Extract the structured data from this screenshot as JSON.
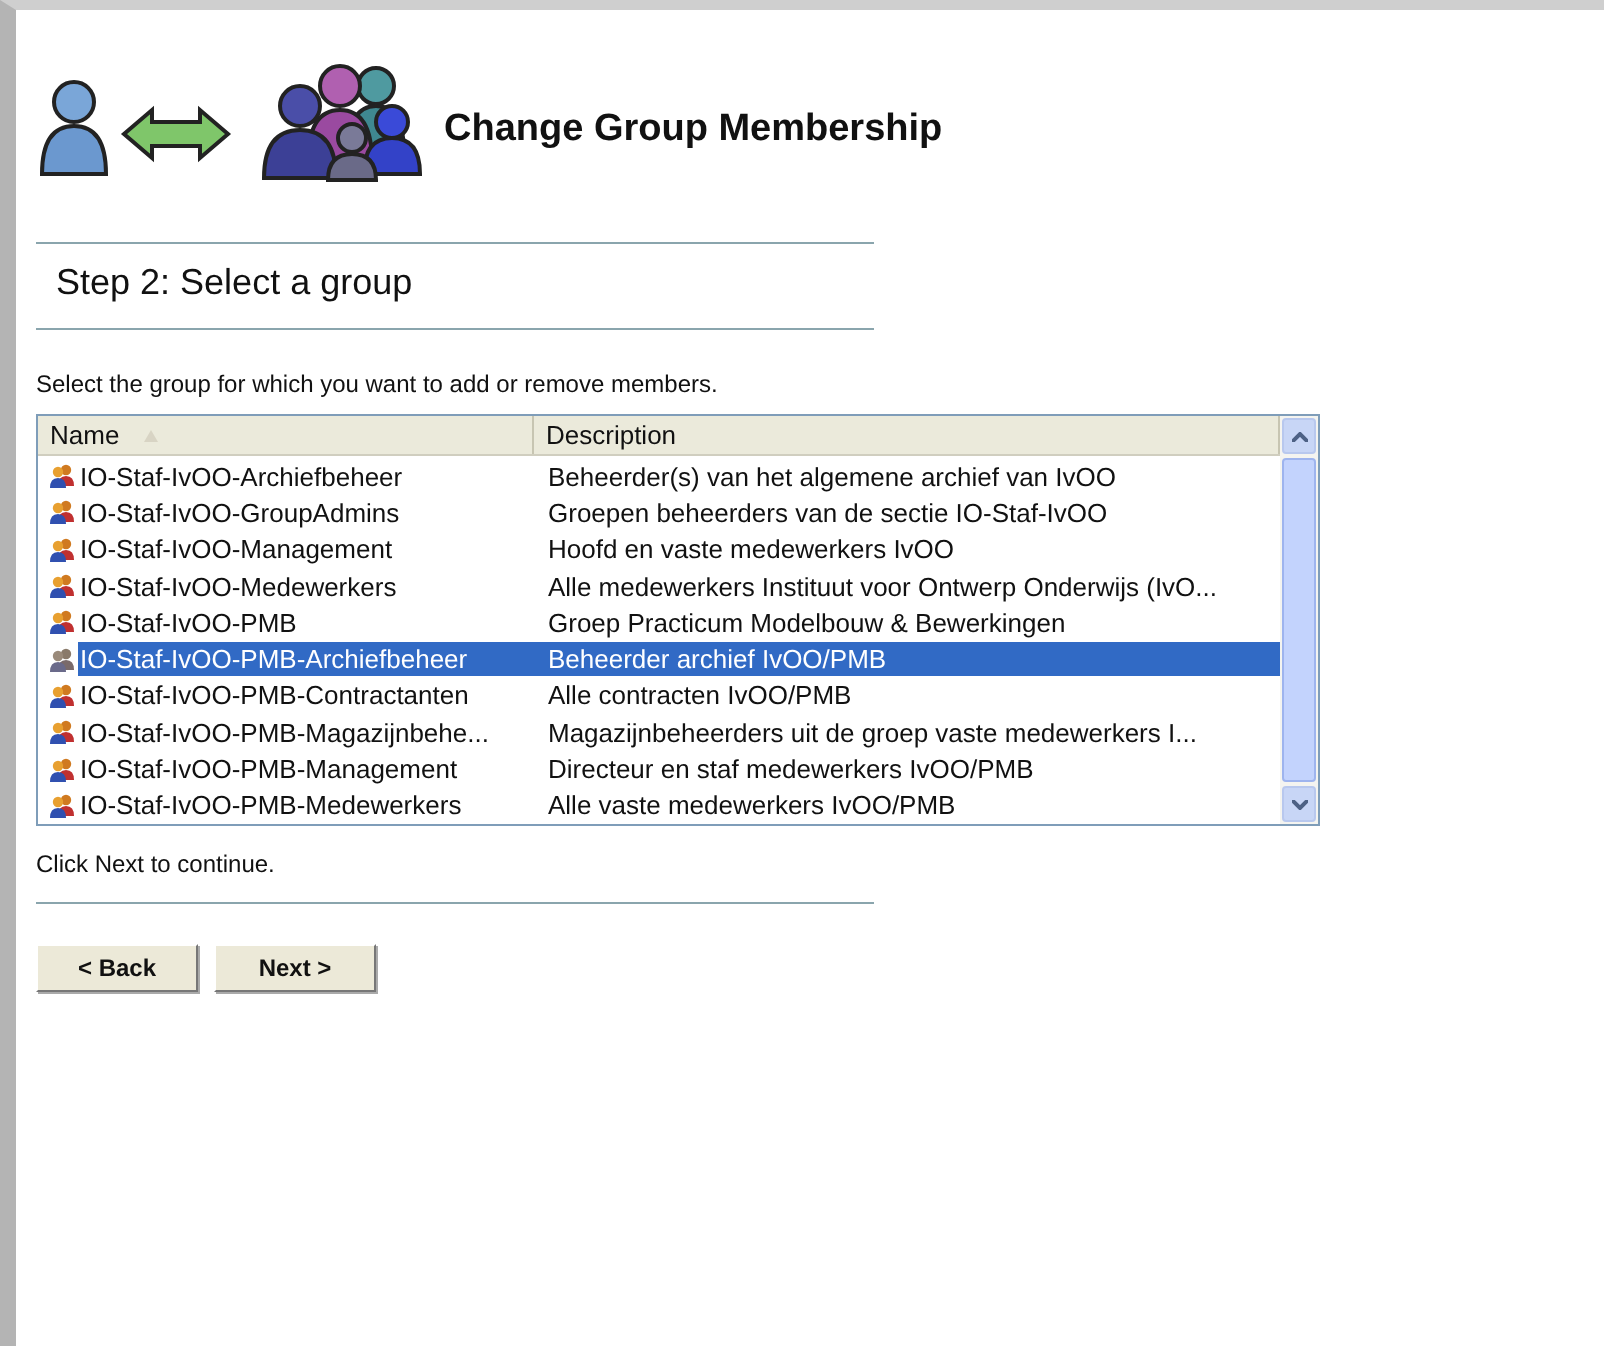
{
  "header": {
    "title": "Change Group Membership"
  },
  "step": {
    "title": "Step 2: Select a group"
  },
  "instruction": "Select the group for which you want to add or remove members.",
  "table": {
    "columns": [
      {
        "label": "Name",
        "sorted": true
      },
      {
        "label": "Description",
        "sorted": false
      }
    ],
    "rows": [
      {
        "name": "IO-Staf-IvOO-Archiefbeheer",
        "description": "Beheerder(s) van het algemene archief van IvOO",
        "selected": false
      },
      {
        "name": "IO-Staf-IvOO-GroupAdmins",
        "description": "Groepen beheerders van de sectie IO-Staf-IvOO",
        "selected": false
      },
      {
        "name": "IO-Staf-IvOO-Management",
        "description": "Hoofd en vaste medewerkers IvOO",
        "selected": false
      },
      {
        "name": "IO-Staf-IvOO-Medewerkers",
        "description": "Alle medewerkers Instituut voor Ontwerp Onderwijs (IvO...",
        "selected": false
      },
      {
        "name": "IO-Staf-IvOO-PMB",
        "description": "Groep Practicum Modelbouw & Bewerkingen",
        "selected": false
      },
      {
        "name": "IO-Staf-IvOO-PMB-Archiefbeheer",
        "description": "Beheerder archief IvOO/PMB",
        "selected": true
      },
      {
        "name": "IO-Staf-IvOO-PMB-Contractanten",
        "description": "Alle contracten IvOO/PMB",
        "selected": false
      },
      {
        "name": "IO-Staf-IvOO-PMB-Magazijnbehe...",
        "description": "Magazijnbeheerders uit de groep vaste medewerkers I...",
        "selected": false
      },
      {
        "name": "IO-Staf-IvOO-PMB-Management",
        "description": "Directeur en staf medewerkers IvOO/PMB",
        "selected": false
      },
      {
        "name": "IO-Staf-IvOO-PMB-Medewerkers",
        "description": "Alle vaste medewerkers IvOO/PMB",
        "selected": false
      }
    ]
  },
  "footer_note": "Click Next to continue.",
  "buttons": [
    {
      "label": "< Back"
    },
    {
      "label": "Next >"
    }
  ]
}
